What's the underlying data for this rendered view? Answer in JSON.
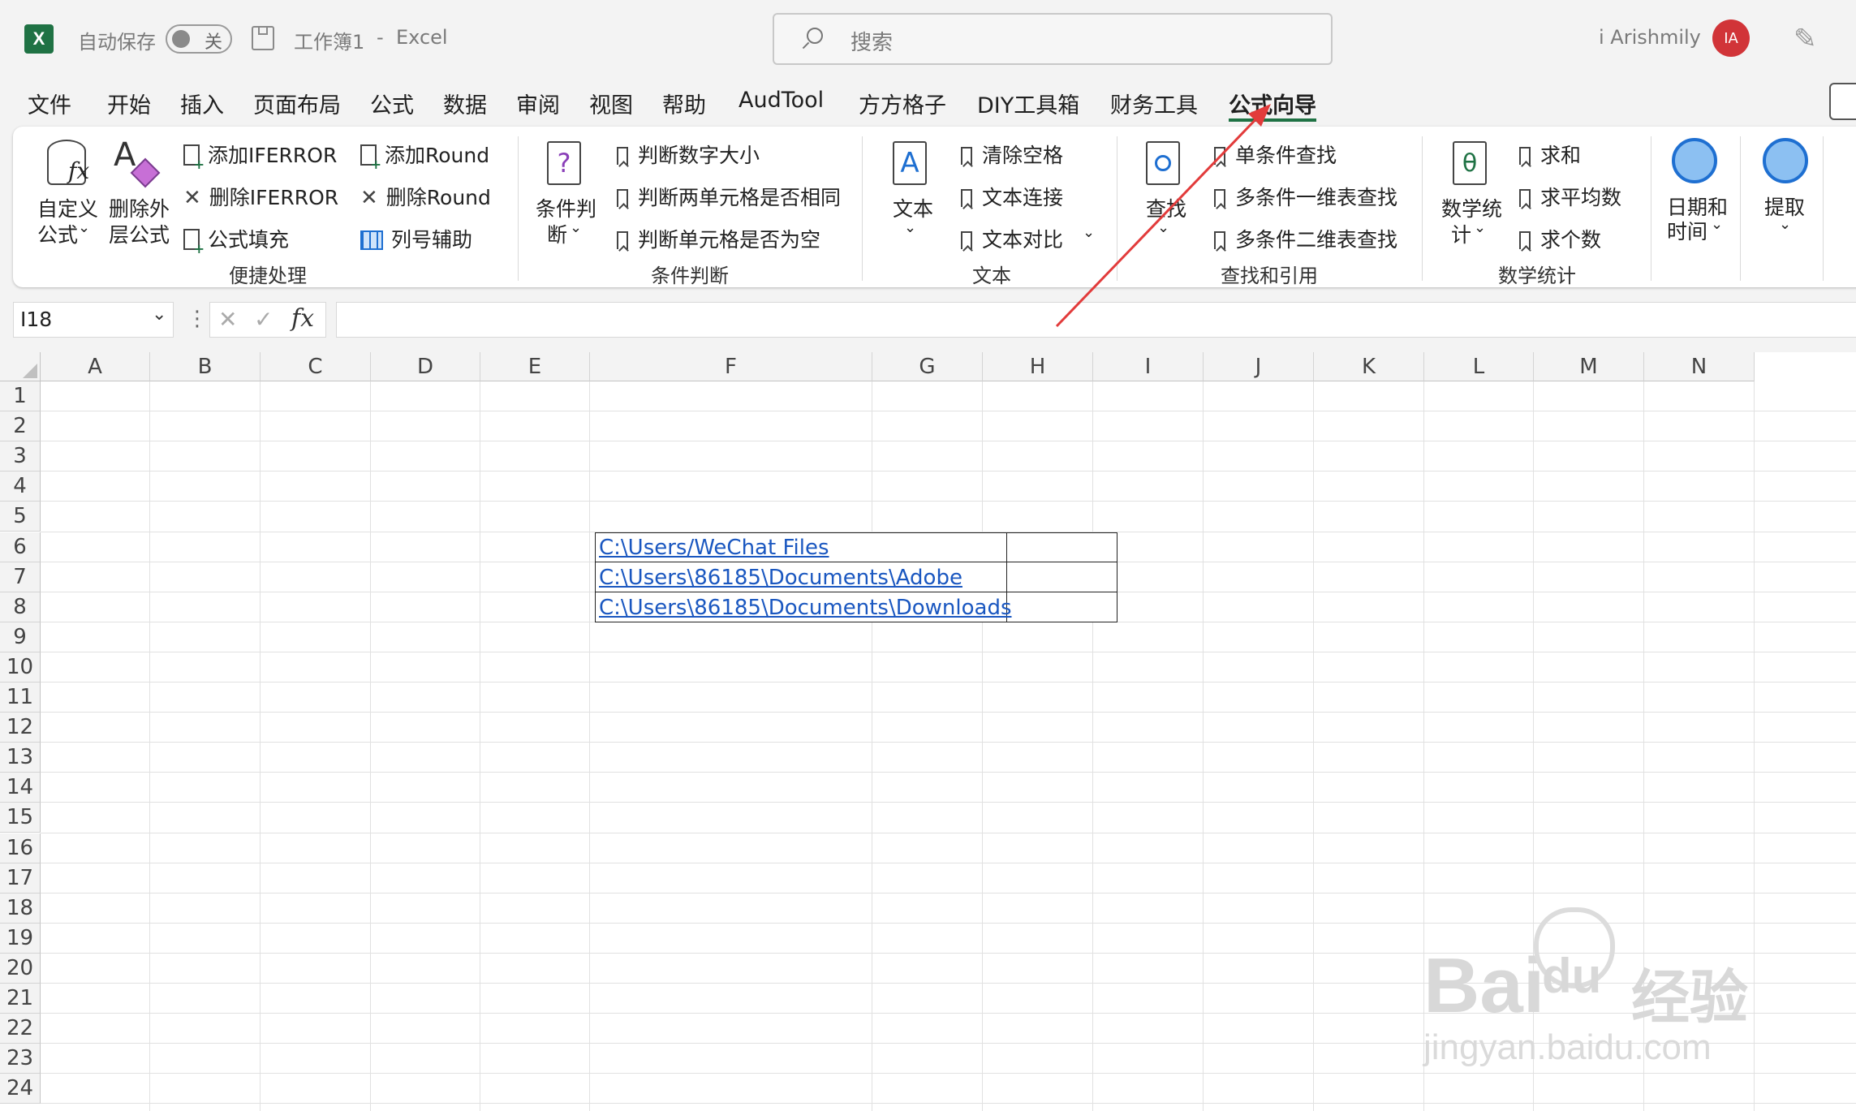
{
  "titlebar": {
    "autosave_label": "自动保存",
    "autosave_state": "关",
    "doc_title": "工作簿1",
    "separator": "-",
    "app_name": "Excel",
    "search_placeholder": "搜索",
    "user_name": "i Arishmily",
    "avatar_initials": "IA"
  },
  "menu": {
    "tabs": [
      "文件",
      "开始",
      "插入",
      "页面布局",
      "公式",
      "数据",
      "审阅",
      "视图",
      "帮助",
      "AudTool",
      "方方格子",
      "DIY工具箱",
      "财务工具",
      "公式向导"
    ],
    "active_tab": "公式向导"
  },
  "ribbon": {
    "group1": {
      "big1": [
        "自定义",
        "公式"
      ],
      "big2": [
        "删除外",
        "层公式"
      ],
      "items": [
        "添加IFERROR",
        "删除IFERROR",
        "公式填充",
        "添加Round",
        "删除Round",
        "列号辅助"
      ],
      "label": "便捷处理"
    },
    "group2": {
      "big": [
        "条件判",
        "断"
      ],
      "items": [
        "判断数字大小",
        "判断两单元格是否相同",
        "判断单元格是否为空"
      ],
      "label": "条件判断"
    },
    "group3": {
      "big": "文本",
      "items": [
        "清除空格",
        "文本连接",
        "文本对比"
      ],
      "label": "文本"
    },
    "group4": {
      "big": "查找",
      "items": [
        "单条件查找",
        "多条件一维表查找",
        "多条件二维表查找"
      ],
      "label": "查找和引用"
    },
    "group5": {
      "big": [
        "数学统",
        "计"
      ],
      "items": [
        "求和",
        "求平均数",
        "求个数"
      ],
      "label": "数学统计"
    },
    "group6": {
      "big": [
        "日期和",
        "时间"
      ]
    },
    "group7": {
      "big": "提取"
    }
  },
  "formula_bar": {
    "name_box": "I18",
    "fx": "fx",
    "content": ""
  },
  "sheet": {
    "columns": [
      "A",
      "B",
      "C",
      "D",
      "E",
      "F",
      "G",
      "H",
      "I",
      "J",
      "K",
      "L",
      "M",
      "N"
    ],
    "rows": [
      "1",
      "2",
      "3",
      "4",
      "5",
      "6",
      "7",
      "8",
      "9",
      "10",
      "11",
      "12",
      "13",
      "14",
      "15",
      "16",
      "17",
      "18",
      "19",
      "20",
      "21",
      "22",
      "23",
      "24"
    ],
    "links": [
      "C:\\Users/WeChat Files",
      "C:\\Users\\86185\\Documents\\Adobe",
      "C:\\Users\\86185\\Documents\\Downloads"
    ]
  },
  "watermark": {
    "brand": "Bai",
    "brand2": "du",
    "cn": "经验",
    "url": "jingyan.baidu.com"
  },
  "colors": {
    "excel_green": "#1f7244",
    "link_blue": "#1a57c0",
    "avatar_red": "#d13438",
    "arrow_red": "#e23b3b"
  }
}
